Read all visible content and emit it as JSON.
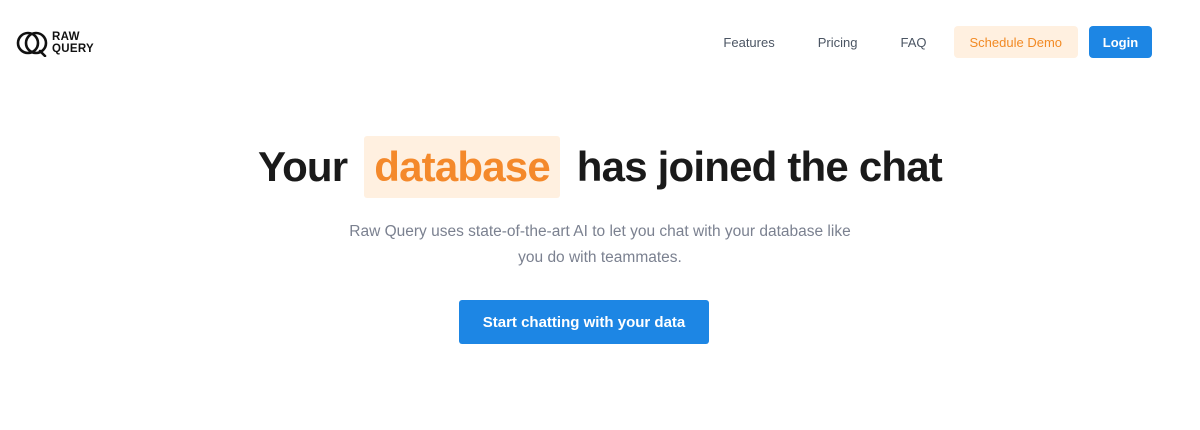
{
  "brand": {
    "logo_line1": "RAW",
    "logo_line2": "QUERY",
    "logo_icon": "double-ring-logo-icon"
  },
  "nav": {
    "items": [
      {
        "label": "Features"
      },
      {
        "label": "Pricing"
      },
      {
        "label": "FAQ"
      }
    ],
    "schedule_demo_label": "Schedule Demo",
    "login_label": "Login"
  },
  "hero": {
    "title_before": "Your",
    "title_highlight": "database",
    "title_after": "has joined the chat",
    "subtitle_line1": "Raw Query uses state-of-the-art AI to let you chat with your database like",
    "subtitle_line2": "you do with teammates.",
    "cta_label": "Start chatting with your data"
  },
  "colors": {
    "primary": "#1d86e4",
    "accent": "#f4892b",
    "accent_bg": "#fff0e0",
    "text_dark": "#1a1a1a",
    "text_muted": "#7b8190"
  }
}
